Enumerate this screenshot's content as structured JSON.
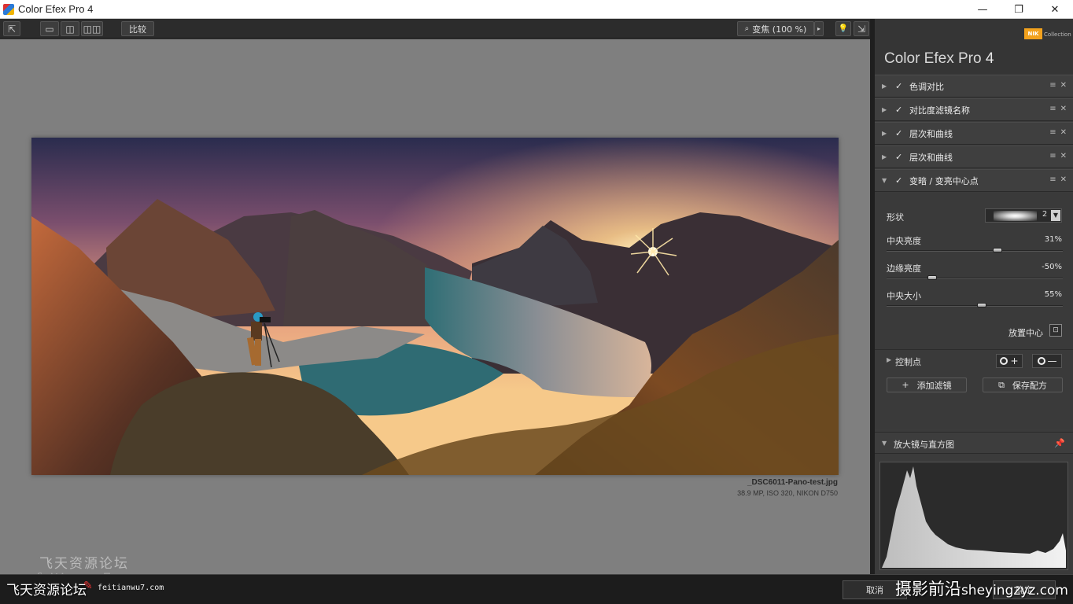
{
  "window": {
    "title": "Color Efex Pro 4",
    "minimize": "—",
    "restore": "❐",
    "close": "✕"
  },
  "toolbar": {
    "exit_glyph": "⇱",
    "view_single": "▭",
    "view_split": "◫",
    "view_side": "◫◫",
    "compare_label": "比较",
    "zoom_label": "变焦 (100 %)",
    "zoom_arrow": "▸",
    "bulb_glyph": "💡",
    "export_glyph": "⇲"
  },
  "image": {
    "filename": "_DSC6011-Pano-test.jpg",
    "meta": "38.9 MP, ISO 320, NIKON D750"
  },
  "canvas_watermark": {
    "line1": "飞天资源论坛",
    "line2": "feitianwu7.com"
  },
  "panel": {
    "brand_prefix": "Color Efex Pro ",
    "brand_num": "4",
    "nik_badge": "NIK",
    "collection": "Collection",
    "filters": [
      {
        "name": "色调对比",
        "expanded": false
      },
      {
        "name": "对比度滤镜名称",
        "expanded": false
      },
      {
        "name": "层次和曲线",
        "expanded": false
      },
      {
        "name": "层次和曲线",
        "expanded": false
      },
      {
        "name": "变暗 / 变亮中心点",
        "expanded": true
      }
    ],
    "filter_glyphs": {
      "collapsed": "▶",
      "expanded": "▼",
      "check": "✓",
      "menu": "≡",
      "remove": "✕"
    },
    "controls": {
      "shape_label": "形状",
      "shape_value": "2",
      "shape_dropdown": "▼",
      "sliders": [
        {
          "label": "中央亮度",
          "value": "31%",
          "position": 0.63
        },
        {
          "label": "边缘亮度",
          "value": "-50%",
          "position": 0.26
        },
        {
          "label": "中央大小",
          "value": "55%",
          "position": 0.54
        }
      ],
      "place_center": "放置中心",
      "place_icon": "⊡"
    },
    "control_points": {
      "label": "控制点",
      "add": "+",
      "remove": "—"
    },
    "actions": {
      "add_filter": "添加滤镜",
      "add_glyph": "+",
      "save_recipe": "保存配方",
      "save_glyph": "⧉"
    },
    "loupe": {
      "label": "放大镜与直方图",
      "pin": "📌"
    }
  },
  "statusbar": {
    "cancel": "取消",
    "ok": "确定",
    "watermark_left": "飞天资源论坛",
    "watermark_left_url": "feitianwu7.com",
    "watermark_left_icon": "✎",
    "watermark_right": "摄影前沿",
    "watermark_right_url": "sheyingzyz.com"
  }
}
